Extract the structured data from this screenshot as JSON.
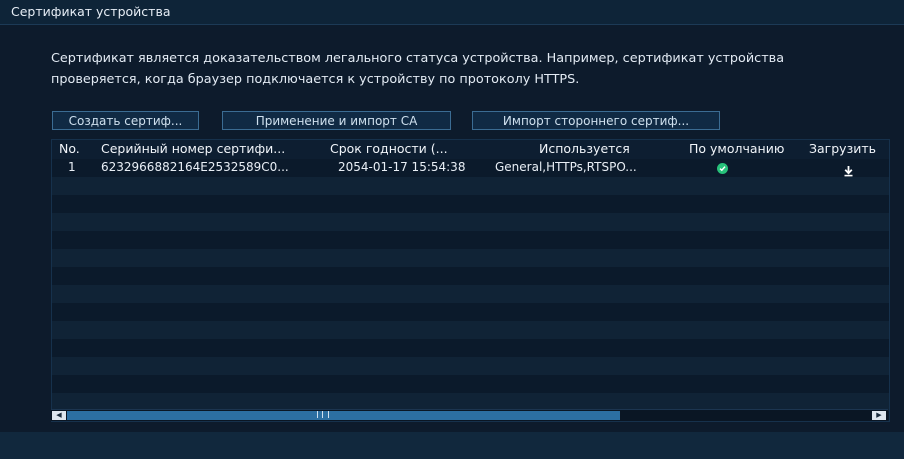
{
  "window": {
    "title": "Сертификат устройства"
  },
  "description": "Сертификат является доказательством легального статуса устройства. Например, сертификат устройства проверяется, когда браузер подключается к устройству по протоколу HTTPS.",
  "toolbar": {
    "create_label": "Создать сертиф...",
    "apply_import_ca_label": "Применение и импорт CA",
    "import_third_party_label": "Импорт стороннего сертиф..."
  },
  "table": {
    "columns": [
      "No.",
      "Серийный номер сертифи...",
      "Срок годности (...",
      "Используется",
      "По умолчанию",
      "Загрузить"
    ],
    "rows": [
      {
        "no": "1",
        "serial": "6232966882164E2532589C0...",
        "expiry": "2054-01-17 15:54:38",
        "used_by": "General,HTTPs,RTSPO...",
        "default_icon": "check-circle-icon",
        "download_icon": "download-icon"
      }
    ]
  },
  "colors": {
    "accent": "#2c6fa2",
    "ok_green": "#27c17a"
  }
}
